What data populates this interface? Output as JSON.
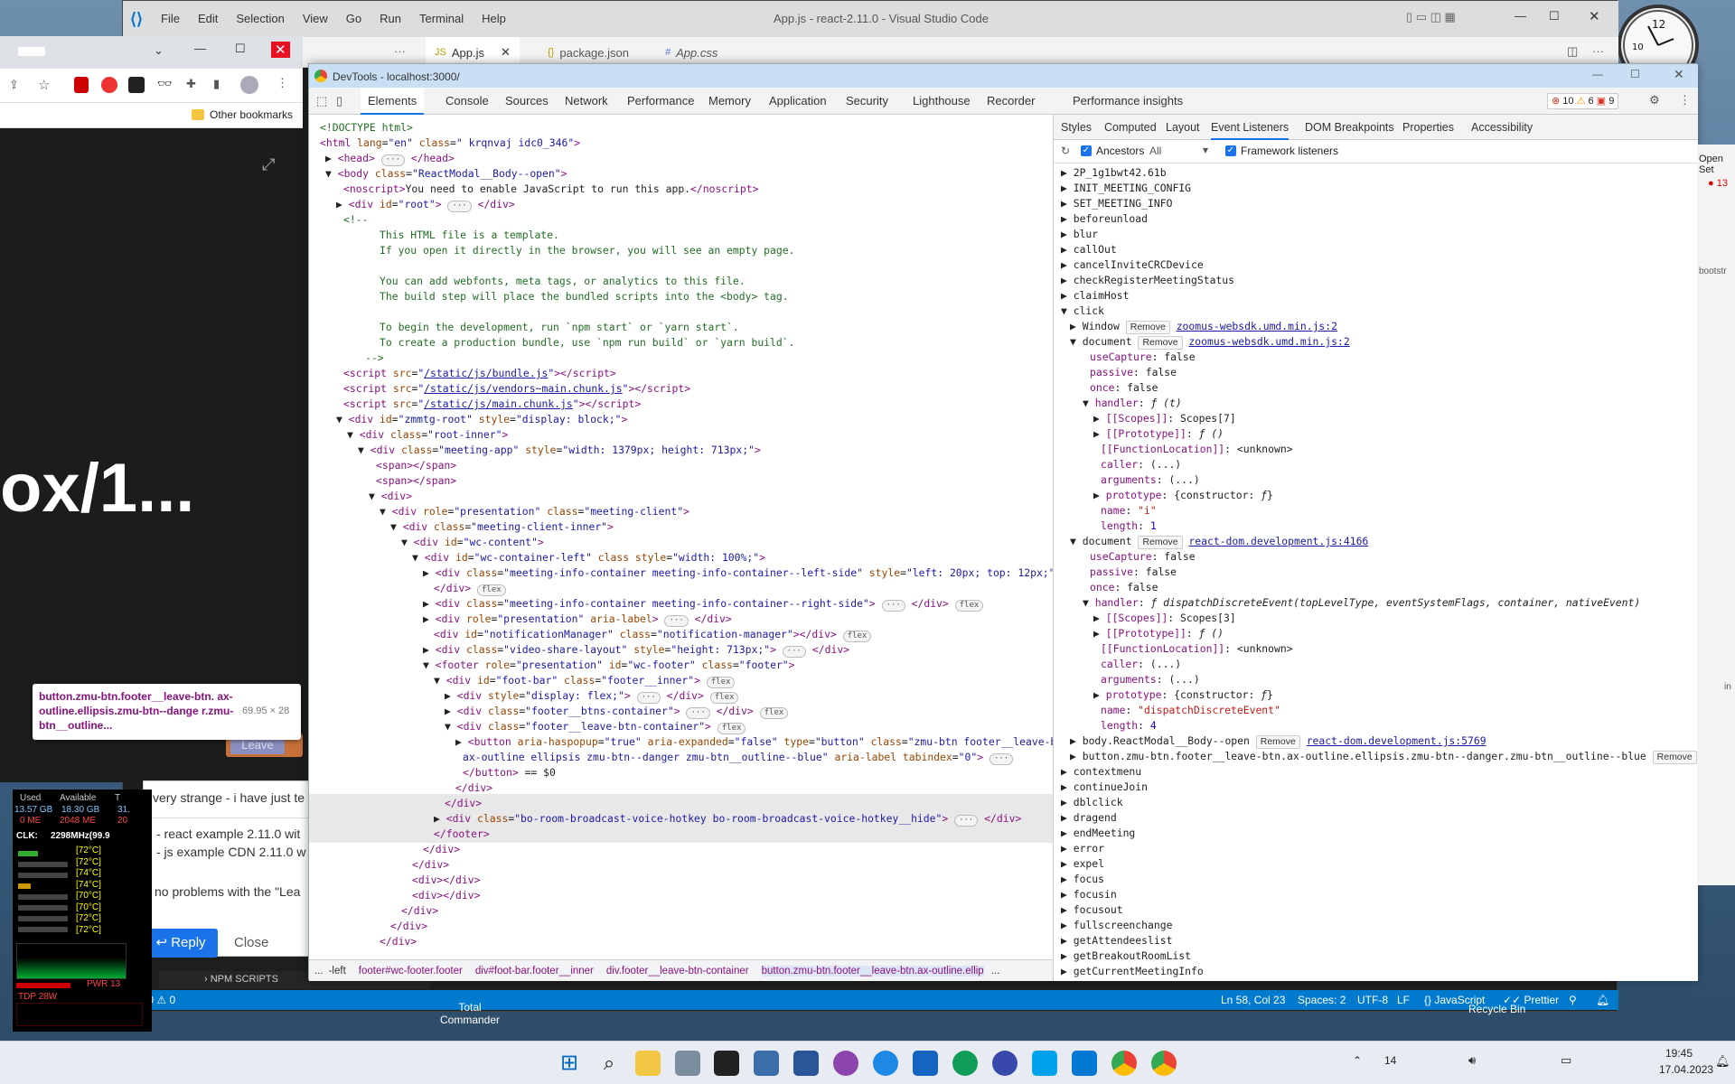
{
  "vscode": {
    "menu": [
      "File",
      "Edit",
      "Selection",
      "View",
      "Go",
      "Run",
      "Terminal",
      "Help"
    ],
    "title": "App.js - react-2.11.0 - Visual Studio Code",
    "tabs": [
      {
        "label": "App.js",
        "icon": "JS"
      },
      {
        "label": "package.json",
        "icon": "{}"
      },
      {
        "label": "App.css",
        "icon": "#"
      }
    ],
    "npm_scripts": "NPM SCRIPTS",
    "status": {
      "errors": "0",
      "warnings": "0",
      "position": "Ln 58, Col 23",
      "spaces": "Spaces: 2",
      "encoding": "UTF-8",
      "eol": "LF",
      "language": "JavaScript",
      "prettier": "Prettier"
    }
  },
  "chrome": {
    "bookmarks": "Other bookmarks",
    "page_text": "ox/1...",
    "leave_label": "Leave"
  },
  "tooltip": {
    "selector": "button.zmu-btn.footer__leave-btn. ax-outline.ellipsis.zmu-btn--dange r.zmu-btn__outline...",
    "size": "69.95 × 28"
  },
  "card": {
    "lines": [
      "very strange - i have just te",
      "- react example 2.11.0 wit",
      "- js example CDN 2.11.0 w",
      "no problems with the \"Lea"
    ],
    "reply": "Reply",
    "close": "Close"
  },
  "sysmon": {
    "headers": [
      "Used",
      "Available",
      "T"
    ],
    "mem": [
      "13.57 GB",
      "18.30 GB",
      "31."
    ],
    "mem2": [
      "0 ME",
      "2048 ME",
      "20"
    ],
    "clk": "CLK:",
    "clk_val": "2298MHz(99.9",
    "temps": [
      "[72°C]",
      "[72°C]",
      "[74°C]",
      "[74°C]",
      "[70°C]",
      "[70°C]",
      "[72°C]",
      "[72°C]"
    ],
    "tdp": "TDP 28W",
    "pwr": "PWR 13"
  },
  "desktop": {
    "total_commander": "Total\nCommander",
    "recycle": "Recycle Bin"
  },
  "devtools": {
    "title": "DevTools - localhost:3000/",
    "tabs": [
      "Elements",
      "Console",
      "Sources",
      "Network",
      "Performance",
      "Memory",
      "Application",
      "Security",
      "Lighthouse",
      "Recorder",
      "Performance insights"
    ],
    "counts": {
      "errors": "10",
      "warnings": "6",
      "issues": "9"
    },
    "subtabs": [
      "Styles",
      "Computed",
      "Layout",
      "Event Listeners",
      "DOM Breakpoints",
      "Properties",
      "Accessibility"
    ],
    "ancestors": "Ancestors",
    "all": "All",
    "framework": "Framework listeners",
    "breadcrumb": [
      "...",
      "-left",
      "footer#wc-footer.footer",
      "div#foot-bar.footer__inner",
      "div.footer__leave-btn-container",
      "button.zmu-btn.footer__leave-btn.ax-outline.ellip",
      "..."
    ],
    "remove": "Remove"
  },
  "right_panel": {
    "open_set": "Open Set",
    "count": "13",
    "text1": "bootstr",
    "text2": "in"
  },
  "taskbar": {
    "time": "19:45",
    "date": "17.04.2023",
    "lang_count": "14"
  }
}
